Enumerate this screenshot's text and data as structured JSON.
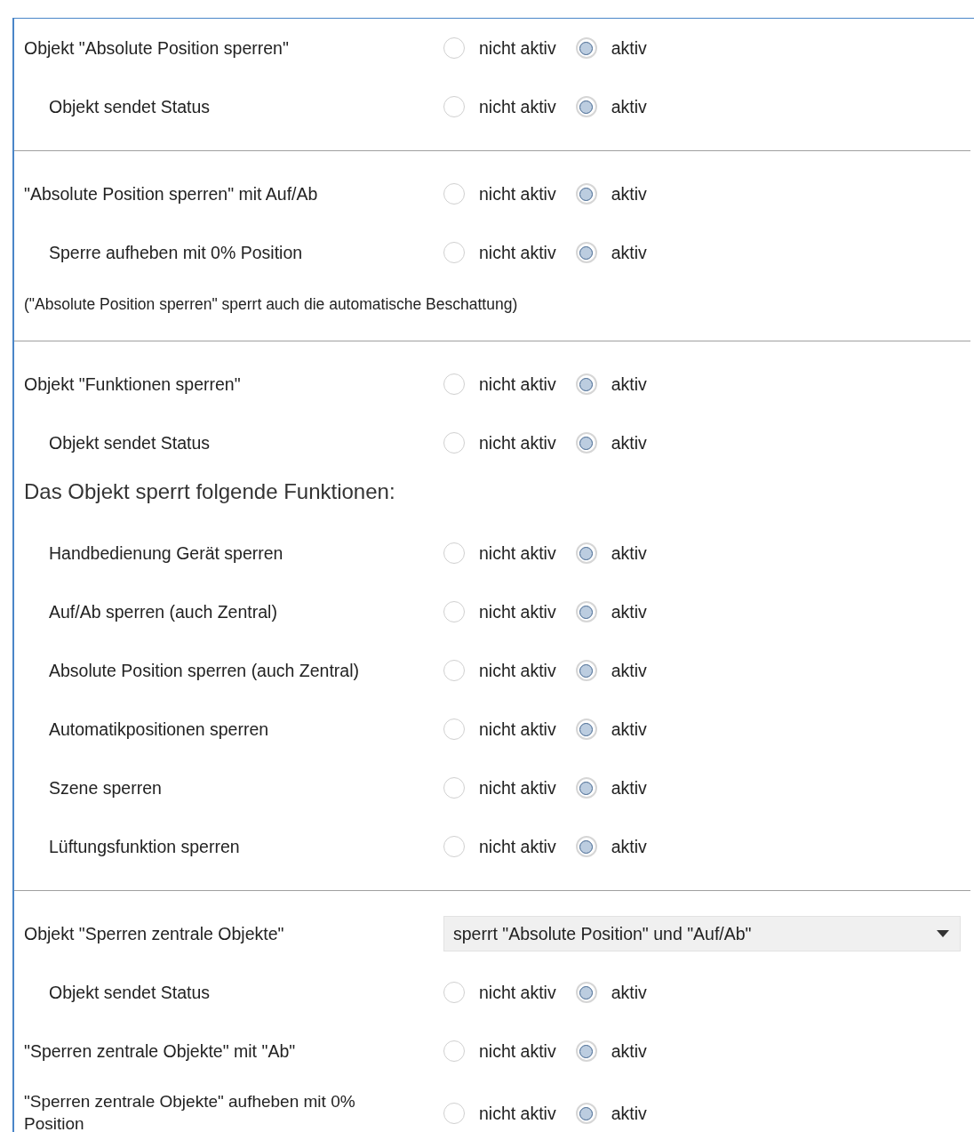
{
  "items": [
    {
      "kind": "radio",
      "label": "Objekt \"Absolute Position sperren\"",
      "indented": false,
      "options": [
        {
          "label": "nicht aktiv",
          "selected": false
        },
        {
          "label": "aktiv",
          "selected": true
        }
      ]
    },
    {
      "kind": "radio",
      "label": "Objekt sendet Status",
      "indented": true,
      "options": [
        {
          "label": "nicht aktiv",
          "selected": false
        },
        {
          "label": "aktiv",
          "selected": true
        }
      ]
    },
    {
      "kind": "divider"
    },
    {
      "kind": "radio",
      "label": "\"Absolute Position sperren\" mit Auf/Ab",
      "indented": false,
      "options": [
        {
          "label": "nicht aktiv",
          "selected": false
        },
        {
          "label": "aktiv",
          "selected": true
        }
      ]
    },
    {
      "kind": "radio",
      "label": "Sperre aufheben mit 0% Position",
      "indented": true,
      "options": [
        {
          "label": "nicht aktiv",
          "selected": false
        },
        {
          "label": "aktiv",
          "selected": true
        }
      ]
    },
    {
      "kind": "note",
      "label": "(\"Absolute Position sperren\" sperrt auch die automatische Beschattung)"
    },
    {
      "kind": "divider"
    },
    {
      "kind": "radio",
      "label": "Objekt \"Funktionen sperren\"",
      "indented": false,
      "options": [
        {
          "label": "nicht aktiv",
          "selected": false
        },
        {
          "label": "aktiv",
          "selected": true
        }
      ]
    },
    {
      "kind": "radio",
      "label": "Objekt sendet Status",
      "indented": true,
      "options": [
        {
          "label": "nicht aktiv",
          "selected": false
        },
        {
          "label": "aktiv",
          "selected": true
        }
      ]
    },
    {
      "kind": "heading",
      "label": "Das Objekt sperrt folgende Funktionen:"
    },
    {
      "kind": "radio",
      "label": "Handbedienung Gerät sperren",
      "indented": true,
      "options": [
        {
          "label": "nicht aktiv",
          "selected": false
        },
        {
          "label": "aktiv",
          "selected": true
        }
      ]
    },
    {
      "kind": "radio",
      "label": "Auf/Ab sperren (auch Zentral)",
      "indented": true,
      "options": [
        {
          "label": "nicht aktiv",
          "selected": false
        },
        {
          "label": "aktiv",
          "selected": true
        }
      ]
    },
    {
      "kind": "radio",
      "label": "Absolute Position sperren (auch Zentral)",
      "indented": true,
      "options": [
        {
          "label": "nicht aktiv",
          "selected": false
        },
        {
          "label": "aktiv",
          "selected": true
        }
      ]
    },
    {
      "kind": "radio",
      "label": "Automatikpositionen sperren",
      "indented": true,
      "options": [
        {
          "label": "nicht aktiv",
          "selected": false
        },
        {
          "label": "aktiv",
          "selected": true
        }
      ]
    },
    {
      "kind": "radio",
      "label": "Szene sperren",
      "indented": true,
      "options": [
        {
          "label": "nicht aktiv",
          "selected": false
        },
        {
          "label": "aktiv",
          "selected": true
        }
      ]
    },
    {
      "kind": "radio",
      "label": "Lüftungsfunktion sperren",
      "indented": true,
      "options": [
        {
          "label": "nicht aktiv",
          "selected": false
        },
        {
          "label": "aktiv",
          "selected": true
        }
      ]
    },
    {
      "kind": "divider"
    },
    {
      "kind": "dropdown",
      "label": "Objekt \"Sperren zentrale Objekte\"",
      "indented": false,
      "value": "sperrt \"Absolute Position\" und \"Auf/Ab\""
    },
    {
      "kind": "radio",
      "label": "Objekt sendet Status",
      "indented": true,
      "options": [
        {
          "label": "nicht aktiv",
          "selected": false
        },
        {
          "label": "aktiv",
          "selected": true
        }
      ]
    },
    {
      "kind": "radio",
      "label": "\"Sperren zentrale Objekte\" mit \"Ab\"",
      "indented": false,
      "options": [
        {
          "label": "nicht aktiv",
          "selected": false
        },
        {
          "label": "aktiv",
          "selected": true
        }
      ]
    },
    {
      "kind": "radio",
      "label": "\"Sperren zentrale Objekte\" aufheben mit 0% Position",
      "indented": false,
      "tall": true,
      "options": [
        {
          "label": "nicht aktiv",
          "selected": false
        },
        {
          "label": "aktiv",
          "selected": true
        }
      ]
    }
  ]
}
